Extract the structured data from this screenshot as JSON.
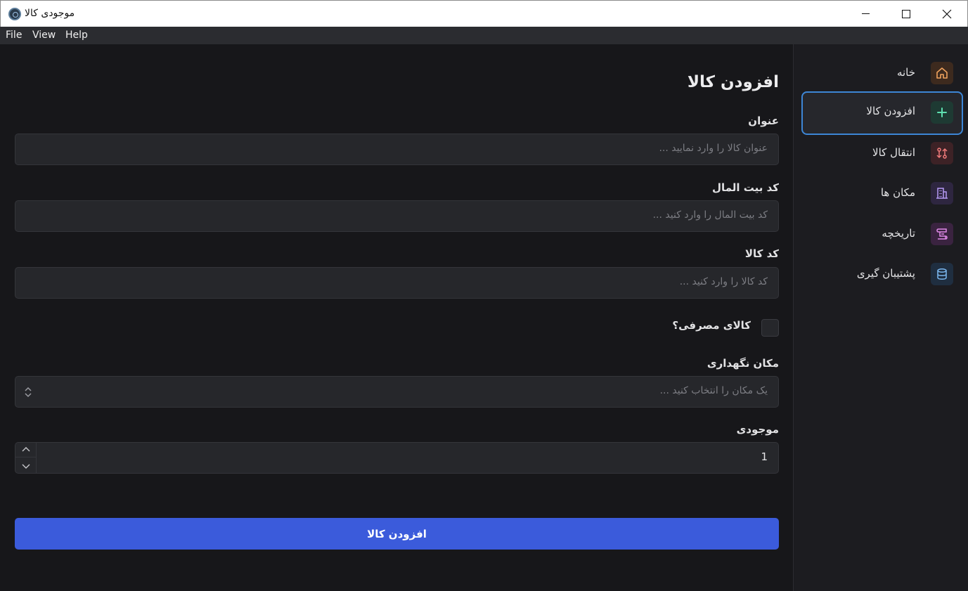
{
  "window": {
    "title": "موجودی کالا"
  },
  "menu": [
    "File",
    "View",
    "Help"
  ],
  "form": {
    "title": "افزودن کالا",
    "fields": [
      {
        "label": "عنوان",
        "placeholder": "عنوان کالا را وارد نمایید ..."
      },
      {
        "label": "کد بیت المال",
        "placeholder": "کد بیت المال را وارد کنید ..."
      },
      {
        "label": "کد کالا",
        "placeholder": "کد کالا را وارد کنید ..."
      }
    ],
    "consumable_label": "کالای مصرفی؟",
    "consumable_checked": false,
    "location": {
      "label": "مکان نگهداری",
      "placeholder": "یک مکان را انتخاب کنید ..."
    },
    "stock": {
      "label": "موجودی",
      "value": "1"
    },
    "submit_label": "افزودن کالا"
  },
  "sidebar": {
    "items": [
      {
        "label": "خانه",
        "icon": "home-icon",
        "color": "#f0a35e",
        "bg": "#3d2a1e",
        "active": false
      },
      {
        "label": "افزودن کالا",
        "icon": "plus-icon",
        "color": "#5ee0b0",
        "bg": "#1e3a33",
        "active": true
      },
      {
        "label": "انتقال کالا",
        "icon": "transfer-icon",
        "color": "#f07a7a",
        "bg": "#3d2226",
        "active": false
      },
      {
        "label": "مکان ها",
        "icon": "building-icon",
        "color": "#b59af5",
        "bg": "#2e2640",
        "active": false
      },
      {
        "label": "تاریخچه",
        "icon": "scroll-icon",
        "color": "#e08ae8",
        "bg": "#3a2340",
        "active": false
      },
      {
        "label": "پشتیبان گیری",
        "icon": "database-icon",
        "color": "#7cb8f0",
        "bg": "#1f2e40",
        "active": false
      }
    ]
  }
}
